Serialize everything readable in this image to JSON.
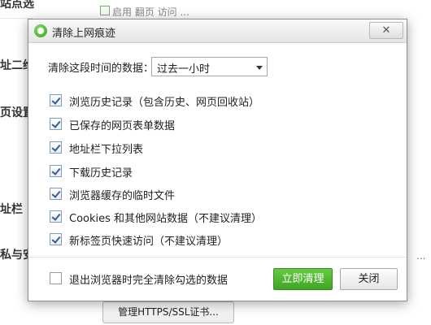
{
  "background": {
    "labels": [
      "站点选",
      "址二维",
      "页设置",
      "址栏",
      "私与安"
    ],
    "top_text": "启用    翻页 访问    ...",
    "right_text": "...",
    "manage_cert_button": "管理HTTPS/SSL证书..."
  },
  "dialog": {
    "title": "清除上网痕迹",
    "close_glyph": "✕",
    "period_label": "清除这段时间的数据：",
    "period_value": "过去一小时",
    "options": [
      {
        "label": "浏览历史记录（包含历史、网页回收站）",
        "checked": true
      },
      {
        "label": "已保存的网页表单数据",
        "checked": true
      },
      {
        "label": "地址栏下拉列表",
        "checked": true
      },
      {
        "label": "下载历史记录",
        "checked": true
      },
      {
        "label": "浏览器缓存的临时文件",
        "checked": true
      },
      {
        "label": "Cookies 和其他网站数据（不建议清理）",
        "checked": true
      },
      {
        "label": "新标签页快速访问（不建议清理）",
        "checked": true
      }
    ],
    "exit_option": {
      "label": "退出浏览器时完全清除勾选的数据",
      "checked": false
    },
    "clear_button": "立即清理",
    "close_button": "关闭"
  },
  "colors": {
    "accent_green": "#3ea524"
  }
}
